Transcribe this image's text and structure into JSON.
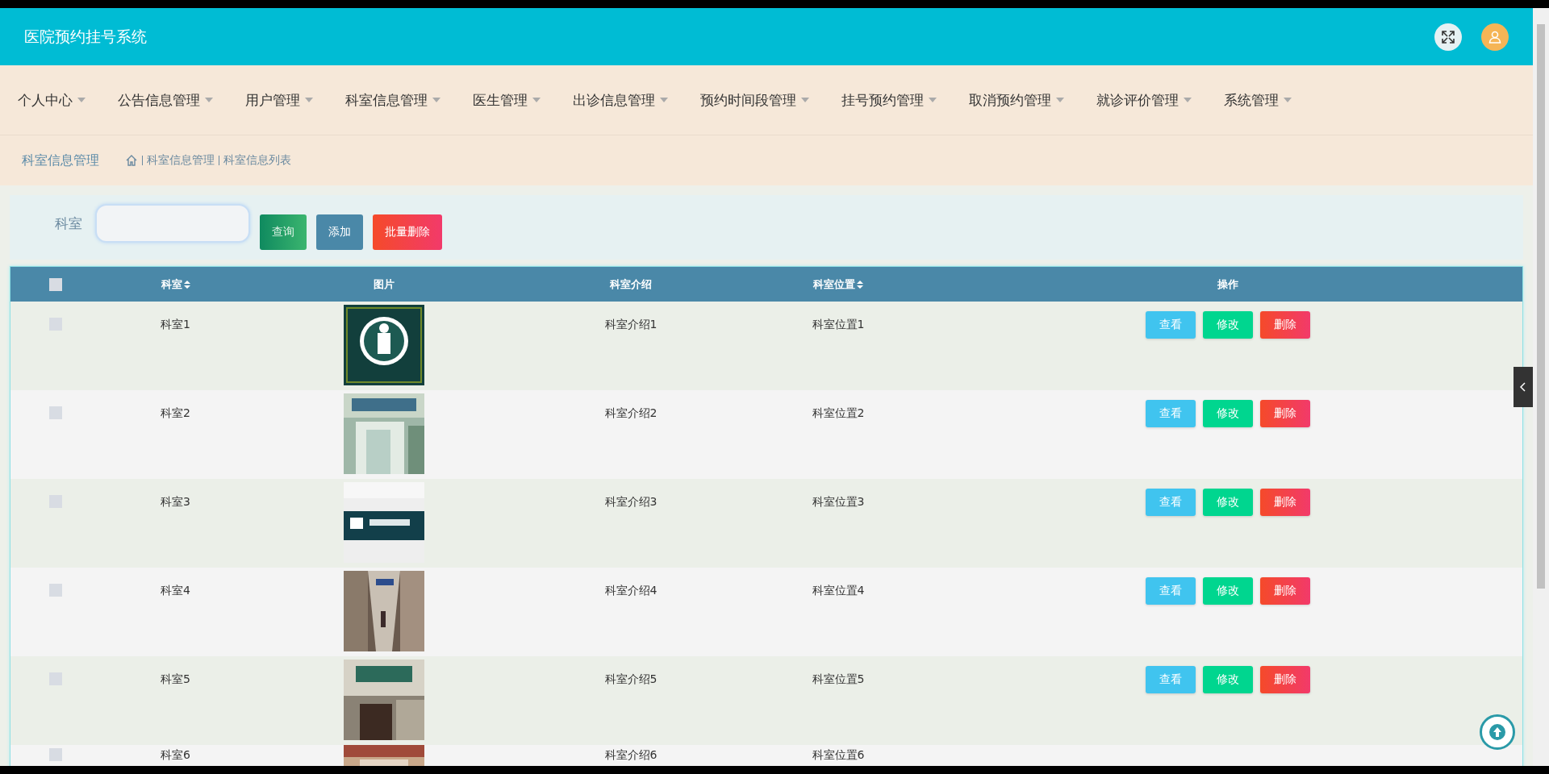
{
  "header": {
    "title": "医院预约挂号系统"
  },
  "nav": [
    {
      "label": "个人中心"
    },
    {
      "label": "公告信息管理"
    },
    {
      "label": "用户管理"
    },
    {
      "label": "科室信息管理"
    },
    {
      "label": "医生管理"
    },
    {
      "label": "出诊信息管理"
    },
    {
      "label": "预约时间段管理"
    },
    {
      "label": "挂号预约管理"
    },
    {
      "label": "取消预约管理"
    },
    {
      "label": "就诊评价管理"
    },
    {
      "label": "系统管理"
    }
  ],
  "breadcrumb": {
    "title": "科室信息管理",
    "path": [
      "科室信息管理",
      "科室信息列表"
    ]
  },
  "search": {
    "label": "科室"
  },
  "buttons": [
    {
      "label": "查询",
      "kind": "search"
    },
    {
      "label": "添加",
      "kind": "add"
    },
    {
      "label": "批量删除",
      "kind": "delete"
    }
  ],
  "table": {
    "select_all": {
      "checked": false
    },
    "columns": [
      {
        "label": "科室",
        "sortable": true
      },
      {
        "label": "图片",
        "sortable": false
      },
      {
        "label": "科室介绍",
        "sortable": false
      },
      {
        "label": "科室位置",
        "sortable": true
      },
      {
        "label": "操作",
        "sortable": false
      }
    ],
    "rows": [
      {
        "checked": false,
        "name": "科室1",
        "intro": "科室介绍1",
        "location": "科室位置1",
        "actions": [
          {
            "label": "查看",
            "kind": "view"
          },
          {
            "label": "修改",
            "kind": "edit"
          },
          {
            "label": "删除",
            "kind": "delete"
          }
        ]
      },
      {
        "checked": false,
        "name": "科室2",
        "intro": "科室介绍2",
        "location": "科室位置2",
        "actions": [
          {
            "label": "查看",
            "kind": "view"
          },
          {
            "label": "修改",
            "kind": "edit"
          },
          {
            "label": "删除",
            "kind": "delete"
          }
        ]
      },
      {
        "checked": false,
        "name": "科室3",
        "intro": "科室介绍3",
        "location": "科室位置3",
        "actions": [
          {
            "label": "查看",
            "kind": "view"
          },
          {
            "label": "修改",
            "kind": "edit"
          },
          {
            "label": "删除",
            "kind": "delete"
          }
        ]
      },
      {
        "checked": false,
        "name": "科室4",
        "intro": "科室介绍4",
        "location": "科室位置4",
        "actions": [
          {
            "label": "查看",
            "kind": "view"
          },
          {
            "label": "修改",
            "kind": "edit"
          },
          {
            "label": "删除",
            "kind": "delete"
          }
        ]
      },
      {
        "checked": false,
        "name": "科室5",
        "intro": "科室介绍5",
        "location": "科室位置5",
        "actions": [
          {
            "label": "查看",
            "kind": "view"
          },
          {
            "label": "修改",
            "kind": "edit"
          },
          {
            "label": "删除",
            "kind": "delete"
          }
        ]
      },
      {
        "checked": false,
        "name": "科室6",
        "intro": "科室介绍6",
        "location": "科室位置6"
      }
    ]
  }
}
